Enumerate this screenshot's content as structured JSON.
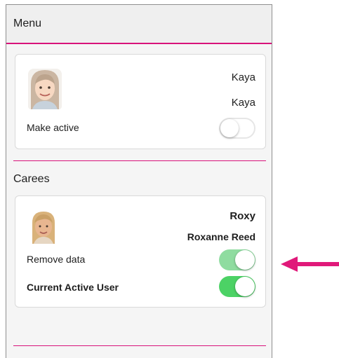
{
  "header": {
    "title": "Menu"
  },
  "current_user": {
    "name": "Kaya",
    "display_name": "Kaya",
    "make_active_label": "Make active",
    "make_active_on": false
  },
  "carees": {
    "title": "Carees",
    "user": {
      "nickname": "Roxy",
      "full_name": "Roxanne Reed",
      "remove_data_label": "Remove data",
      "remove_data_on": true,
      "current_active_label": "Current Active User",
      "current_active_on": true
    }
  },
  "colors": {
    "accent": "#d8127a",
    "toggle_on": "#4cd265",
    "toggle_on_light": "#8fdca0"
  }
}
